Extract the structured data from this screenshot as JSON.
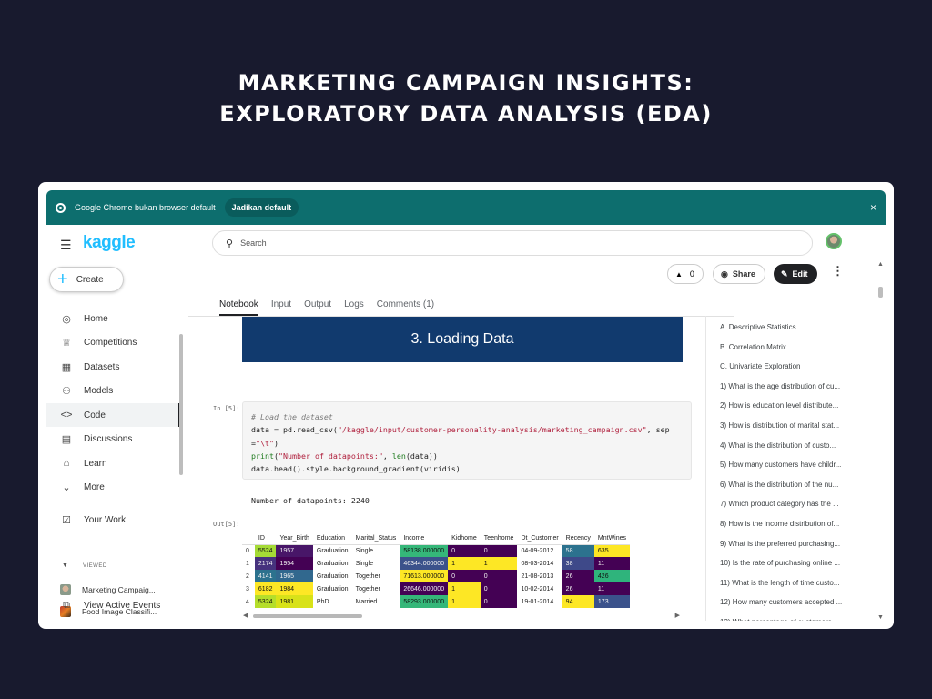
{
  "header": {
    "title_line1": "MARKETING CAMPAIGN INSIGHTS:",
    "title_line2": "EXPLORATORY DATA ANALYSIS (EDA)"
  },
  "infobar": {
    "message": "Google Chrome bukan browser default",
    "button": "Jadikan default",
    "close": "×"
  },
  "sidebar": {
    "logo": "kaggle",
    "create_label": "Create",
    "items": [
      {
        "label": "Home",
        "icon": "compass-icon"
      },
      {
        "label": "Competitions",
        "icon": "trophy-icon"
      },
      {
        "label": "Datasets",
        "icon": "table-icon"
      },
      {
        "label": "Models",
        "icon": "models-icon"
      },
      {
        "label": "Code",
        "icon": "code-icon"
      },
      {
        "label": "Discussions",
        "icon": "discussion-icon"
      },
      {
        "label": "Learn",
        "icon": "school-icon"
      },
      {
        "label": "More",
        "icon": "chevron-down-icon"
      }
    ],
    "your_work": "Your Work",
    "viewed_label": "VIEWED",
    "recent": [
      {
        "label": "Marketing Campaig..."
      },
      {
        "label": "Food Image Classifi..."
      }
    ],
    "view_events": "View Active Events"
  },
  "search": {
    "placeholder": "Search"
  },
  "toolbar": {
    "vote_count": "0",
    "share_label": "Share",
    "edit_label": "Edit"
  },
  "tabs": [
    "Notebook",
    "Input",
    "Output",
    "Logs",
    "Comments (1)"
  ],
  "notebook": {
    "section_title": "3. Loading Data",
    "in_prompt": "In [5]:",
    "out_prompt": "Out[5]:",
    "code": {
      "comment": "# Load the dataset",
      "l2a": "data = pd.read_csv(",
      "l2s": "\"/kaggle/input/customer-personality-analysis/marketing_campaign.csv\"",
      "l2b": ", sep",
      "l3a": "=",
      "l3s": "\"\\t\"",
      "l3b": ")",
      "l4f": "print",
      "l4a": "(",
      "l4s": "\"Number of datapoints:\"",
      "l4b": ", ",
      "l4f2": "len",
      "l4c": "(data))",
      "l5": "data.head().style.background_gradient(viridis)"
    },
    "output_text": "Number of datapoints: 2240",
    "table": {
      "columns": [
        "",
        "ID",
        "Year_Birth",
        "Education",
        "Marital_Status",
        "Income",
        "Kidhome",
        "Teenhome",
        "Dt_Customer",
        "Recency",
        "MntWines"
      ],
      "rows": [
        [
          "0",
          "5524",
          "1957",
          "Graduation",
          "Single",
          "58138.000000",
          "0",
          "0",
          "04-09-2012",
          "58",
          "635"
        ],
        [
          "1",
          "2174",
          "1954",
          "Graduation",
          "Single",
          "46344.000000",
          "1",
          "1",
          "08-03-2014",
          "38",
          "11"
        ],
        [
          "2",
          "4141",
          "1965",
          "Graduation",
          "Together",
          "71613.000000",
          "0",
          "0",
          "21-08-2013",
          "26",
          "426"
        ],
        [
          "3",
          "6182",
          "1984",
          "Graduation",
          "Together",
          "26646.000000",
          "1",
          "0",
          "10-02-2014",
          "26",
          "11"
        ],
        [
          "4",
          "5324",
          "1981",
          "PhD",
          "Married",
          "58293.000000",
          "1",
          "0",
          "19-01-2014",
          "94",
          "173"
        ]
      ],
      "colors": [
        [
          "",
          "#a5db36",
          "#481668",
          "",
          "",
          "#35b779",
          "#440154",
          "#440154",
          "",
          "#2c728e",
          "#fde725"
        ],
        [
          "",
          "#46327e",
          "#440154",
          "",
          "",
          "#3b528b",
          "#fde725",
          "#fde725",
          "",
          "#3e4989",
          "#440154"
        ],
        [
          "",
          "#2c728e",
          "#31688e",
          "",
          "",
          "#fde725",
          "#440154",
          "#440154",
          "",
          "#440154",
          "#2fb47c"
        ],
        [
          "",
          "#fde725",
          "#fde725",
          "",
          "",
          "#440154",
          "#fde725",
          "#440154",
          "",
          "#440154",
          "#440154"
        ],
        [
          "",
          "#b5de2b",
          "#d8e219",
          "",
          "",
          "#35b779",
          "#fde725",
          "#440154",
          "",
          "#fde725",
          "#3b528b"
        ]
      ],
      "light_text_colors": [
        "#440154",
        "#481668",
        "#46327e",
        "#3b528b",
        "#3e4989",
        "#2c728e",
        "#31688e"
      ]
    }
  },
  "toc": [
    "A. Descriptive Statistics",
    "B. Correlation Matrix",
    "C. Univariate Exploration",
    "1) What is the age distribution of cu...",
    "2) How is education level distribute...",
    "3) How is distribution of marital stat...",
    "4) What is the distribution of custo...",
    "5) How many customers have childr...",
    "6) What is the distribution of the nu...",
    "7) Which product category has the ...",
    "8) How is the income distribution of...",
    "9) What is the preferred purchasing...",
    "10) Is the rate of purchasing online ...",
    "11) What is the length of time custo...",
    "12) How many customers accepted ...",
    "13) What percentage of customers ..."
  ]
}
